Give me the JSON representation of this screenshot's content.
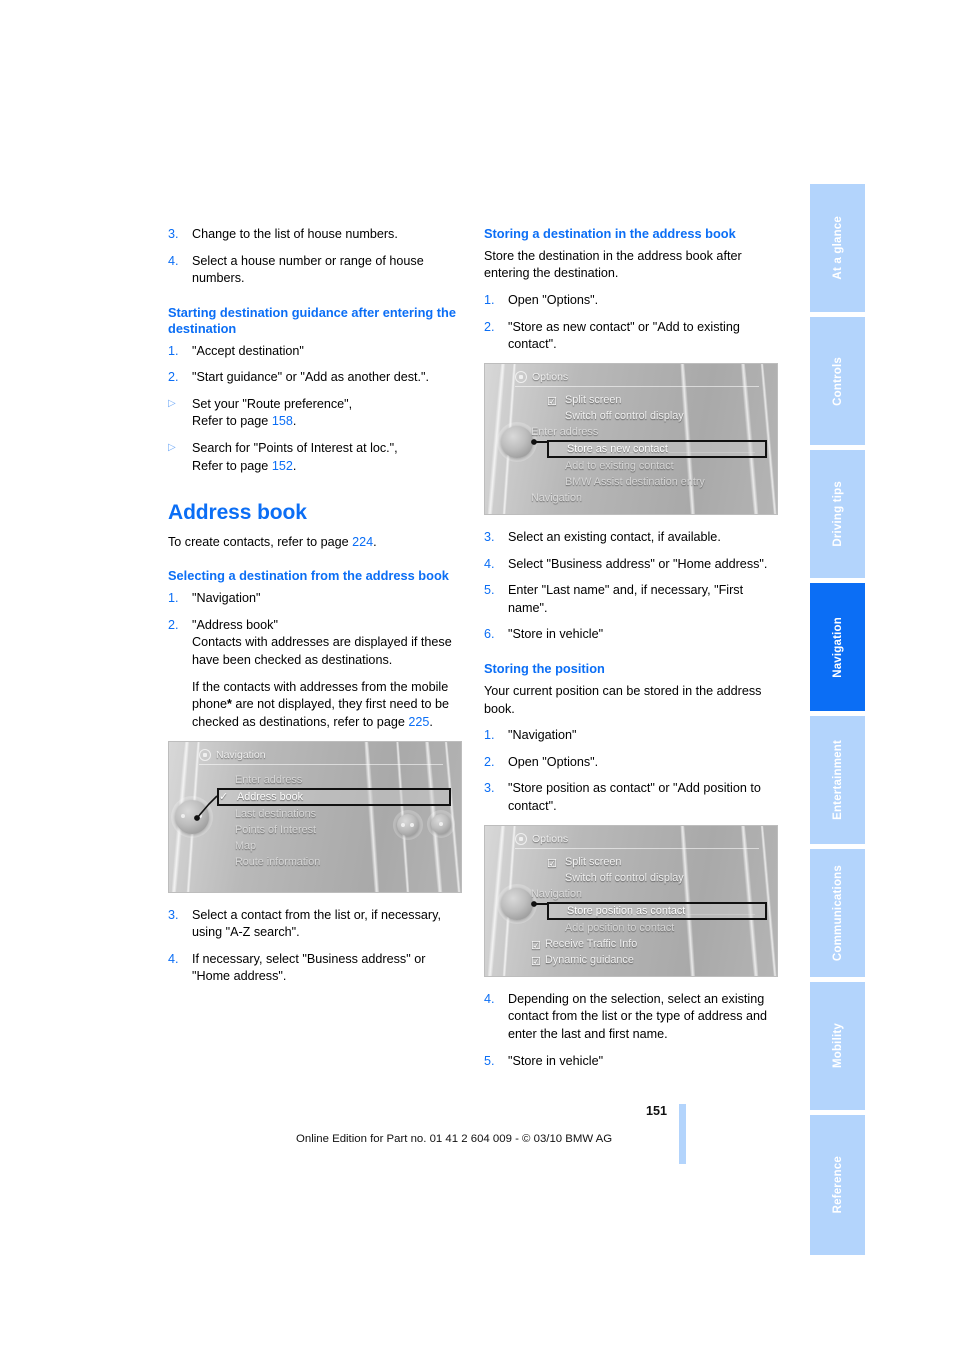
{
  "document": {
    "page_number": "151",
    "footer_note": "Online Edition for Part no. 01 41 2 604 009 - © 03/10 BMW AG",
    "accent_color": "#0b6ef5",
    "tab_inactive_color": "#b3d4fc"
  },
  "side_tabs": [
    {
      "label": "At a glance",
      "active": false
    },
    {
      "label": "Controls",
      "active": false
    },
    {
      "label": "Driving tips",
      "active": false
    },
    {
      "label": "Navigation",
      "active": true
    },
    {
      "label": "Entertainment",
      "active": false
    },
    {
      "label": "Communications",
      "active": false
    },
    {
      "label": "Mobility",
      "active": false
    },
    {
      "label": "Reference",
      "active": false
    }
  ],
  "left_column": {
    "top_steps": [
      {
        "marker": "3.",
        "text": "Change to the list of house numbers."
      },
      {
        "marker": "4.",
        "text": "Select a house number or range of house numbers."
      }
    ],
    "heading_start_guidance": "Starting destination guidance after entering the destination",
    "start_guidance_steps": [
      {
        "marker": "1.",
        "text": "\"Accept destination\""
      },
      {
        "marker": "2.",
        "text": "\"Start guidance\" or \"Add as another dest.\"."
      }
    ],
    "start_guidance_bullets": [
      {
        "marker": "▷",
        "text_before": "Set your \"Route preference\",",
        "refer_prefix": "Refer to page ",
        "page": "158",
        "refer_suffix": "."
      },
      {
        "marker": "▷",
        "text_before": "Search for \"Points of Interest at loc.\",",
        "refer_prefix": "Refer to page ",
        "page": "152",
        "refer_suffix": "."
      }
    ],
    "chapter_title": "Address book",
    "create_contacts_prefix": "To create contacts, refer to page ",
    "create_contacts_page": "224",
    "create_contacts_suffix": ".",
    "heading_selecting": "Selecting a destination from the address book",
    "selecting_steps": [
      {
        "marker": "1.",
        "text": "\"Navigation\""
      },
      {
        "marker": "2.",
        "text": "\"Address book\"",
        "sub_1": "Contacts with addresses are displayed if these have been checked as destinations.",
        "sub_2_a": "If the contacts with addresses from the mobile phone",
        "sub_2_asterisk": "*",
        "sub_2_b": " are not displayed, they first need to be checked as destinations, refer to page ",
        "sub_2_page": "225",
        "sub_2_c": "."
      }
    ],
    "navigation_screen": {
      "header": "Navigation",
      "items": [
        {
          "label": "Enter address",
          "selected": false,
          "checked": false
        },
        {
          "label": "Address book",
          "selected": true,
          "checked": true
        },
        {
          "label": "Last destinations",
          "selected": false,
          "checked": false
        },
        {
          "label": "Points of Interest",
          "selected": false,
          "checked": false
        },
        {
          "label": "Map",
          "selected": false,
          "checked": false
        },
        {
          "label": "Route information",
          "selected": false,
          "checked": false
        }
      ]
    },
    "after_image_steps": [
      {
        "marker": "3.",
        "text": "Select a contact from the list or, if necessary, using \"A-Z search\"."
      },
      {
        "marker": "4.",
        "text": "If necessary, select \"Business address\" or \"Home address\"."
      }
    ]
  },
  "right_column": {
    "heading_storing_destination": "Storing a destination in the address book",
    "storing_destination_intro": "Store the destination in the address book after entering the destination.",
    "storing_destination_steps_pre": [
      {
        "marker": "1.",
        "text": "Open \"Options\"."
      },
      {
        "marker": "2.",
        "text": "\"Store as new contact\" or \"Add to existing contact\"."
      }
    ],
    "options_screen_1": {
      "header": "Options",
      "items": [
        {
          "label": "Split screen",
          "checked": true,
          "selected": false,
          "section": false
        },
        {
          "label": "Switch off control display",
          "checked": false,
          "selected": false,
          "section": false
        },
        {
          "label": "Enter address",
          "checked": false,
          "selected": false,
          "section": true
        },
        {
          "label": "Store as new contact",
          "checked": false,
          "selected": true,
          "section": false
        },
        {
          "label": "Add to existing contact",
          "checked": false,
          "selected": false,
          "section": false
        },
        {
          "label": "BMW Assist destination entry",
          "checked": false,
          "selected": false,
          "section": false
        },
        {
          "label": "Navigation",
          "checked": false,
          "selected": false,
          "section": true
        }
      ]
    },
    "storing_destination_steps_post": [
      {
        "marker": "3.",
        "text": "Select an existing contact, if available."
      },
      {
        "marker": "4.",
        "text": "Select \"Business address\" or \"Home address\"."
      },
      {
        "marker": "5.",
        "text": "Enter \"Last name\" and, if necessary, \"First name\"."
      },
      {
        "marker": "6.",
        "text": "\"Store in vehicle\""
      }
    ],
    "heading_storing_position": "Storing the position",
    "storing_position_intro": "Your current position can be stored in the address book.",
    "storing_position_steps_pre": [
      {
        "marker": "1.",
        "text": "\"Navigation\""
      },
      {
        "marker": "2.",
        "text": "Open \"Options\"."
      },
      {
        "marker": "3.",
        "text": "\"Store position as contact\" or \"Add position to contact\"."
      }
    ],
    "options_screen_2": {
      "header": "Options",
      "items": [
        {
          "label": "Split screen",
          "checked": true,
          "selected": false,
          "section": false
        },
        {
          "label": "Switch off control display",
          "checked": false,
          "selected": false,
          "section": false
        },
        {
          "label": "Navigation",
          "checked": false,
          "selected": false,
          "section": true
        },
        {
          "label": "Store position as contact",
          "checked": false,
          "selected": true,
          "section": false
        },
        {
          "label": "Add position to contact",
          "checked": false,
          "selected": false,
          "section": false
        },
        {
          "label": "Receive Traffic Info",
          "checked": true,
          "selected": false,
          "section": false
        },
        {
          "label": "Dynamic guidance",
          "checked": true,
          "selected": false,
          "section": false
        }
      ]
    },
    "storing_position_steps_post": [
      {
        "marker": "4.",
        "text": "Depending on the selection, select an existing contact from the list or the type of address and enter the last and first name."
      },
      {
        "marker": "5.",
        "text": "\"Store in vehicle\""
      }
    ]
  }
}
